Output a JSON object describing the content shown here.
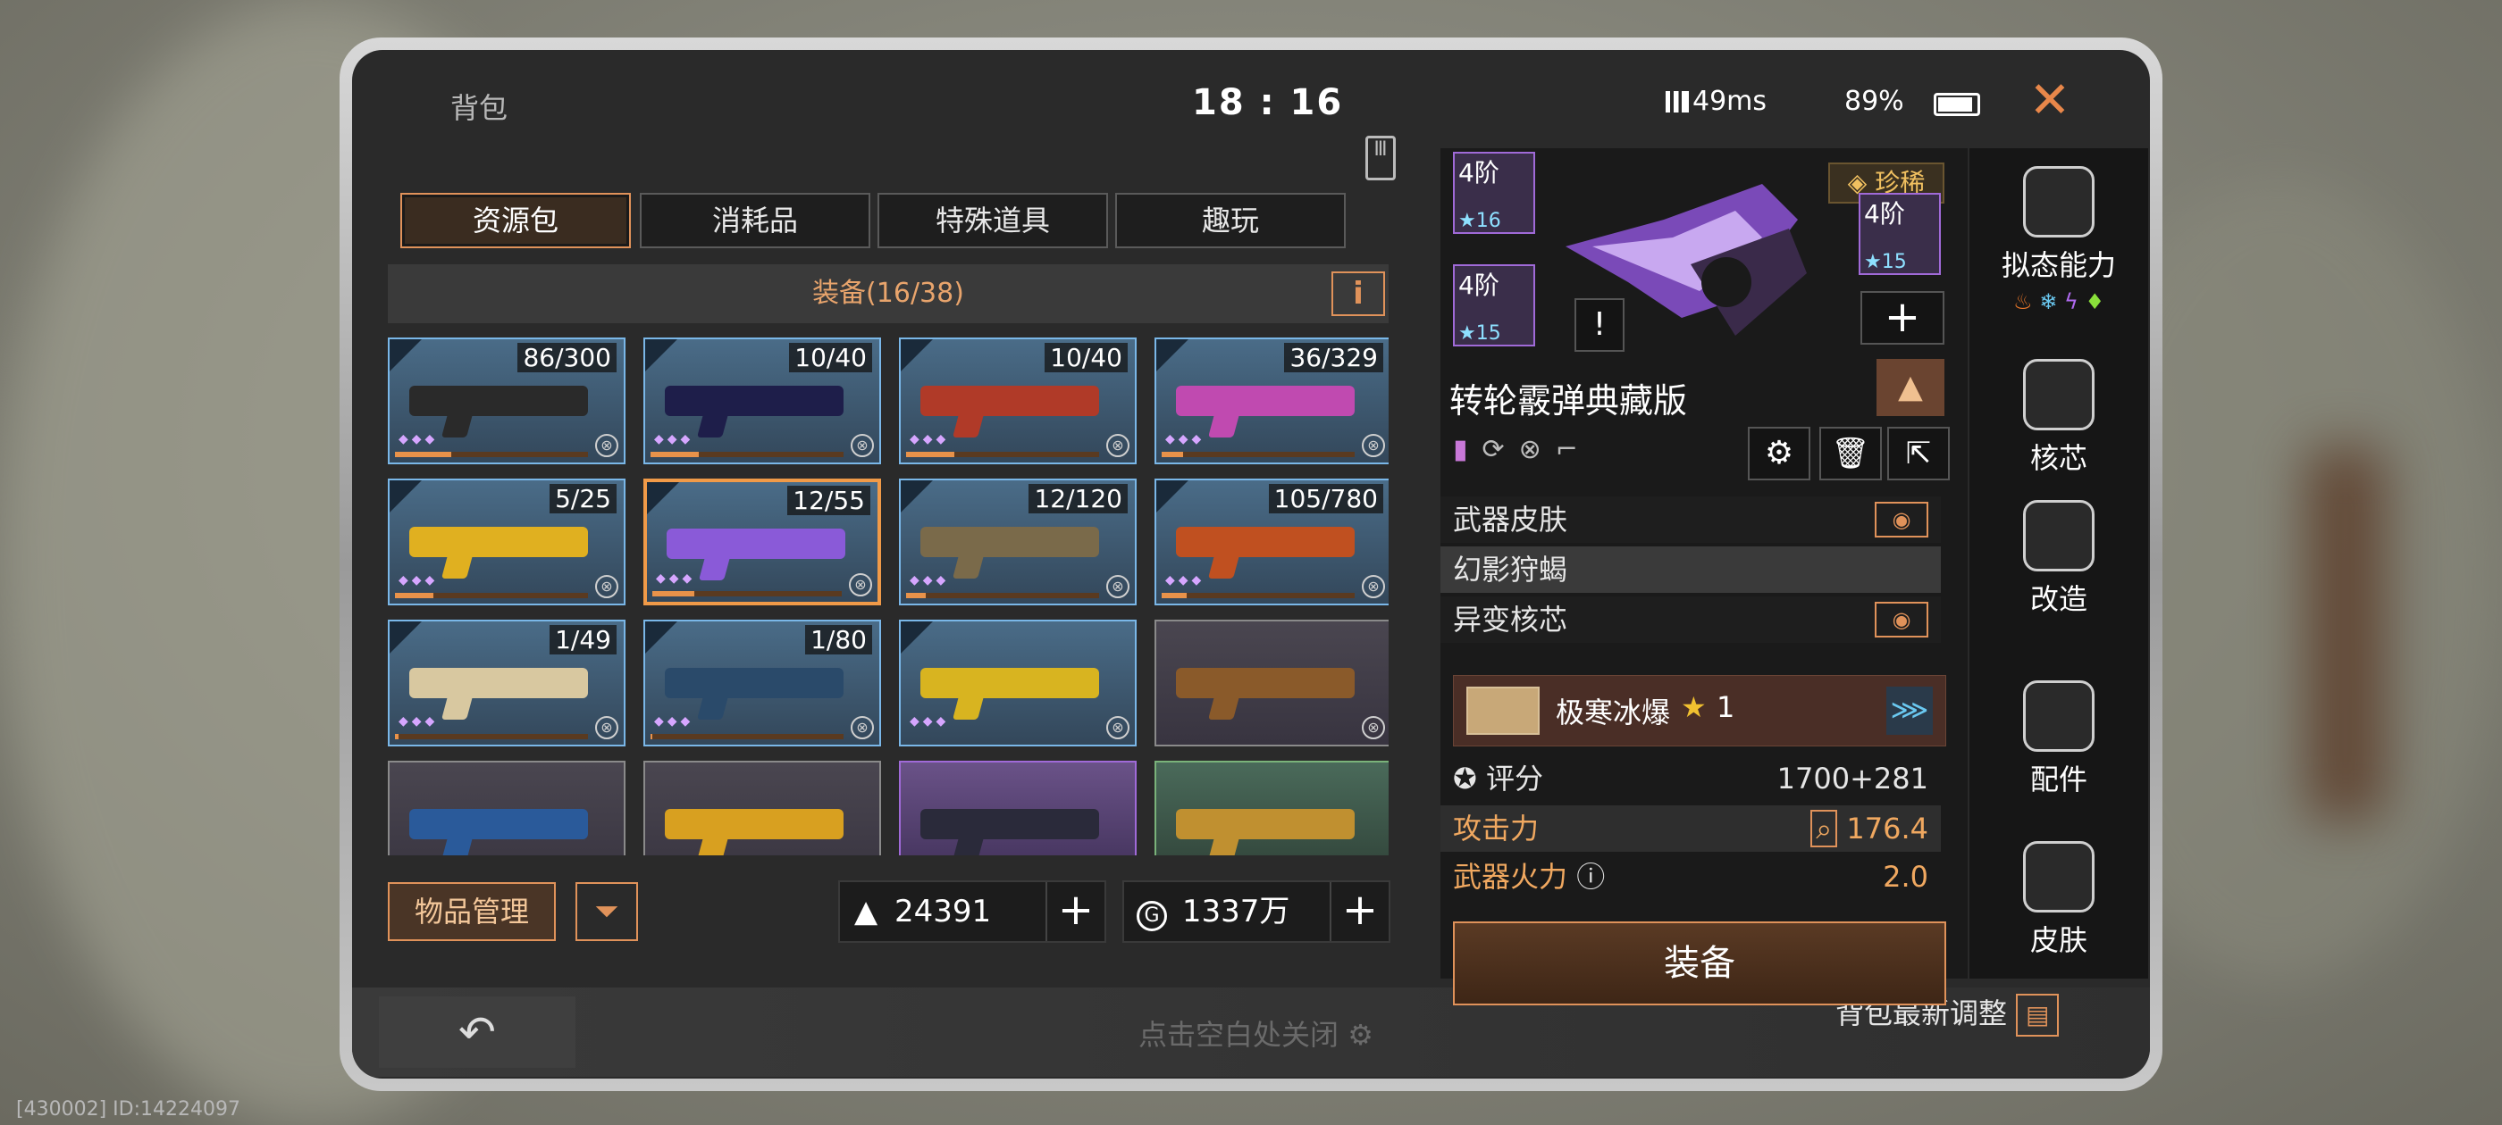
{
  "header": {
    "title": "背包",
    "clock": "18 : 16",
    "ping": "49ms",
    "battery": "89%"
  },
  "tabs": [
    {
      "label": "资源包",
      "active": true
    },
    {
      "label": "消耗品"
    },
    {
      "label": "特殊道具"
    },
    {
      "label": "趣玩"
    }
  ],
  "equipment": {
    "label": "装备(16/38)",
    "info": "i"
  },
  "slots": [
    {
      "count": "86/300",
      "style": "blue",
      "gun": "#2a2a2a",
      "fill": 0.29
    },
    {
      "count": "10/40",
      "style": "blue",
      "gun": "#1e1e4a",
      "fill": 0.25
    },
    {
      "count": "10/40",
      "style": "blue",
      "gun": "#b03a28",
      "fill": 0.25
    },
    {
      "count": "36/329",
      "style": "blue",
      "gun": "#c04ab0",
      "fill": 0.11
    },
    {
      "count": "5/25",
      "style": "blue",
      "gun": "#e0b020",
      "fill": 0.2
    },
    {
      "count": "12/55",
      "style": "sel",
      "gun": "#8a5ad8",
      "fill": 0.22
    },
    {
      "count": "12/120",
      "style": "blue",
      "gun": "#7a6a4a",
      "fill": 0.1
    },
    {
      "count": "105/780",
      "style": "blue",
      "gun": "#c05020",
      "fill": 0.13
    },
    {
      "count": "1/49",
      "style": "blue",
      "gun": "#d8c8a0",
      "fill": 0.02
    },
    {
      "count": "1/80",
      "style": "blue",
      "gun": "#2a4a6a",
      "fill": 0.01
    },
    {
      "count": "",
      "style": "blue",
      "gun": "#d8b420",
      "fill": 0.0
    },
    {
      "count": "",
      "style": "plain",
      "gun": "#8a5a2a",
      "fill": 0.0
    },
    {
      "count": "",
      "style": "plain",
      "gun": "#2a5a9a",
      "fill": 0.0
    },
    {
      "count": "",
      "style": "plain",
      "gun": "#d8a020",
      "fill": 0.0
    },
    {
      "count": "",
      "style": "purple",
      "gun": "#2a2a3a",
      "fill": 0.0
    },
    {
      "count": "",
      "style": "green",
      "gun": "#c09030",
      "fill": 0.0
    }
  ],
  "bottom": {
    "manage_label": "物品管理",
    "gold": "24391",
    "coins": "1337万",
    "hint": "点击空白处关闭",
    "recent": "背包最新调整"
  },
  "detail": {
    "tier_a": "4阶",
    "tier_a_stars": "15",
    "tier_top": "4阶",
    "tier_top_stars": "16",
    "tier_right": "4阶",
    "tier_right_stars": "15",
    "rarity": "珍稀",
    "name": "转轮霰弹典藏版",
    "skin_label": "武器皮肤",
    "skin_value": "幻影狩蝎",
    "core_label": "异变核芯",
    "core_name": "极寒冰爆",
    "core_level": "1",
    "score_label": "评分",
    "score_value": "1700+281",
    "attack_label": "攻击力",
    "attack_value": "176.4",
    "firepower_label": "武器火力",
    "firepower_value": "2.0",
    "equip_label": "装备"
  },
  "side": [
    {
      "label": "拟态能力"
    },
    {
      "label": "核芯"
    },
    {
      "label": "改造"
    },
    {
      "label": "配件"
    },
    {
      "label": "皮肤"
    }
  ],
  "footer": "[430002] ID:14224097"
}
